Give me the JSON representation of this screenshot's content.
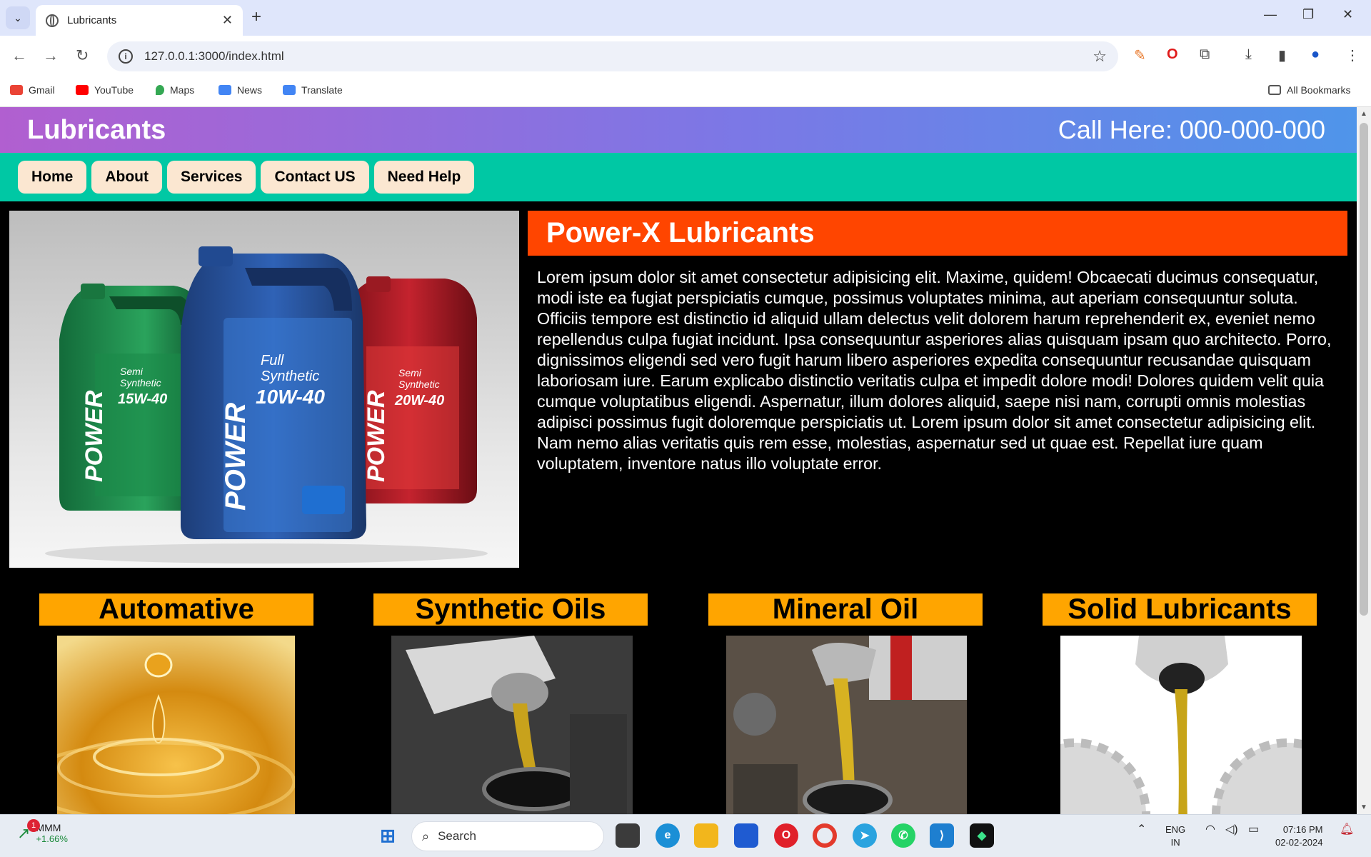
{
  "browser": {
    "tab_title": "Lubricants",
    "url": "127.0.0.1:3000/index.html",
    "bookmarks": [
      "Gmail",
      "YouTube",
      "Maps",
      "News",
      "Translate"
    ],
    "all_bookmarks": "All Bookmarks"
  },
  "site": {
    "title": "Lubricants",
    "phone": "Call Here: 000-000-000",
    "nav": [
      "Home",
      "About",
      "Services",
      "Contact US",
      "Need Help"
    ],
    "intro_title": "Power-X Lubricants",
    "intro_text": "Lorem ipsum dolor sit amet consectetur adipisicing elit. Maxime, quidem! Obcaecati ducimus consequatur, modi iste ea fugiat perspiciatis cumque, possimus voluptates minima, aut aperiam consequuntur soluta. Officiis tempore est distinctio id aliquid ullam delectus velit dolorem harum reprehenderit ex, eveniet nemo repellendus culpa fugiat incidunt. Ipsa consequuntur asperiores alias quisquam ipsam quo architecto. Porro, dignissimos eligendi sed vero fugit harum libero asperiores expedita consequuntur recusandae quisquam laboriosam iure. Earum explicabo distinctio veritatis culpa et impedit dolore modi! Dolores quidem velit quia cumque voluptatibus eligendi. Aspernatur, illum dolores aliquid, saepe nisi nam, corrupti omnis molestias adipisci possimus fugit doloremque perspiciatis ut. Lorem ipsum dolor sit amet consectetur adipisicing elit. Nam nemo alias veritatis quis rem esse, molestias, aspernatur sed ut quae est. Repellat iure quam voluptatem, inventore natus illo voluptate error.",
    "product_labels": {
      "brand": "POWER",
      "left": [
        "Semi",
        "Synthetic",
        "15W-40"
      ],
      "center": [
        "Full",
        "Synthetic",
        "10W-40"
      ],
      "right": [
        "Semi",
        "Synthetic",
        "20W-40"
      ]
    },
    "categories": [
      "Automative",
      "Synthetic Oils",
      "Mineral Oil",
      "Solid Lubricants"
    ]
  },
  "taskbar": {
    "stock_name": "MMM",
    "stock_change": "+1.66%",
    "notification_count": "1",
    "search_placeholder": "Search",
    "lang_line1": "ENG",
    "lang_line2": "IN",
    "time": "07:16 PM",
    "date": "02-02-2024"
  },
  "colors": {
    "header_gradient": [
      "#b15fd0",
      "#4f95ea"
    ],
    "nav_bg": "#00c8a4",
    "nav_button": "#fbe7d1",
    "intro_title_bg": "#ff4500",
    "category_title_bg": "#ffa500"
  }
}
